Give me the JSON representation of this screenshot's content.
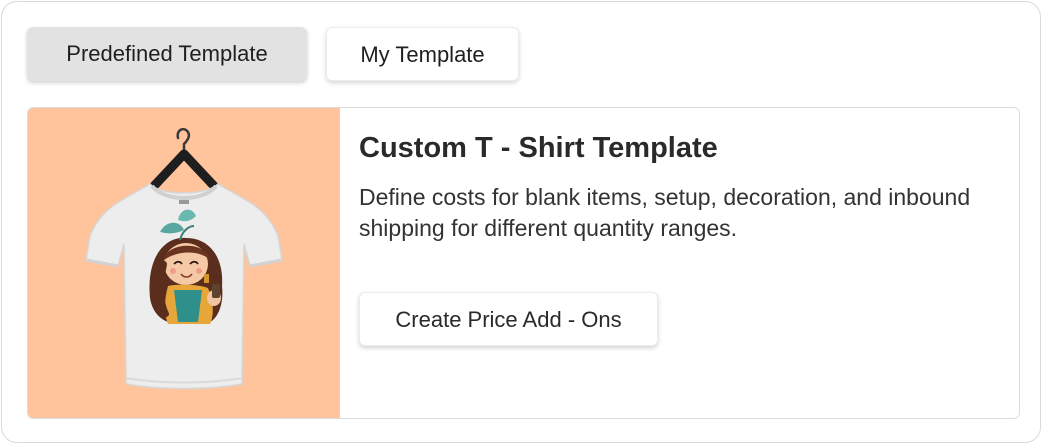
{
  "tabs": [
    {
      "label": "Predefined Template",
      "active": true
    },
    {
      "label": "My Template",
      "active": false
    }
  ],
  "template_card": {
    "image_icon": "tshirt-on-hanger-illustration",
    "image_background": "#ffc49c",
    "title": "Custom T - Shirt Template",
    "description": "Define costs for blank items, setup, decoration, and inbound shipping for different quantity ranges.",
    "cta_label": "Create Price Add - Ons"
  }
}
